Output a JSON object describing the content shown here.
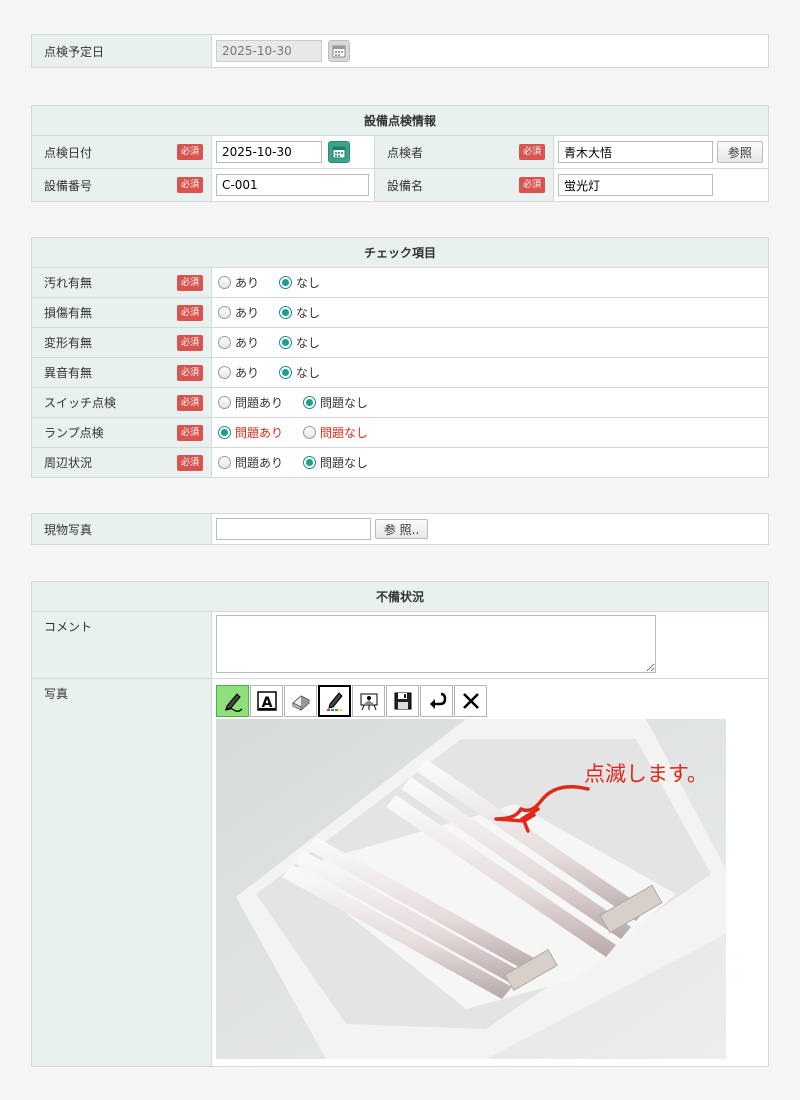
{
  "schedule": {
    "label": "点検予定日",
    "date_value": "2025-10-30"
  },
  "equipment_info": {
    "header": "設備点検情報",
    "required_badge": "必須",
    "inspection_date_label": "点検日付",
    "inspection_date_value": "2025-10-30",
    "inspector_label": "点検者",
    "inspector_value": "青木大悟",
    "inspector_ref_button": "参照",
    "equipment_no_label": "設備番号",
    "equipment_no_value": "C-001",
    "equipment_name_label": "設備名",
    "equipment_name_value": "蛍光灯"
  },
  "check_items": {
    "header": "チェック項目",
    "rows": [
      {
        "label": "汚れ有無",
        "opt_a": "あり",
        "opt_b": "なし",
        "selected": "b"
      },
      {
        "label": "損傷有無",
        "opt_a": "あり",
        "opt_b": "なし",
        "selected": "b"
      },
      {
        "label": "変形有無",
        "opt_a": "あり",
        "opt_b": "なし",
        "selected": "b"
      },
      {
        "label": "異音有無",
        "opt_a": "あり",
        "opt_b": "なし",
        "selected": "b"
      },
      {
        "label": "スイッチ点検",
        "opt_a": "問題あり",
        "opt_b": "問題なし",
        "selected": "b"
      },
      {
        "label": "ランプ点検",
        "opt_a": "問題あり",
        "opt_b": "問題なし",
        "selected": "a",
        "highlight": "#e0291a"
      },
      {
        "label": "周辺状況",
        "opt_a": "問題あり",
        "opt_b": "問題なし",
        "selected": "b"
      }
    ]
  },
  "photo_upload": {
    "label": "現物写真",
    "browse_button": "参 照.."
  },
  "defect": {
    "header": "不備状況",
    "comment_label": "コメント",
    "comment_value": "",
    "photo_label": "写真",
    "toolbar": [
      "pen-icon",
      "text-icon",
      "eraser-icon",
      "color-pen-icon",
      "background-icon",
      "save-icon",
      "undo-icon",
      "clear-icon"
    ],
    "annotation_text": "点滅します。",
    "annotation_color": "#e0291a"
  },
  "colors": {
    "label_bg": "#e8f1ef",
    "accent": "#1a9e8f",
    "required": "#d9534f"
  }
}
